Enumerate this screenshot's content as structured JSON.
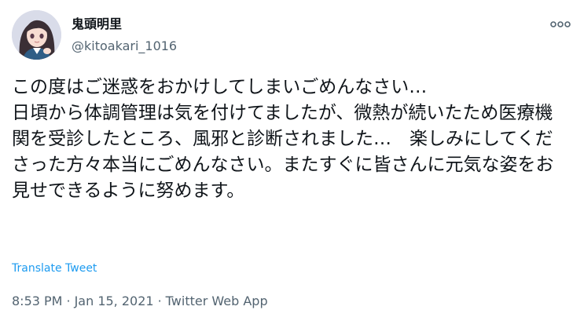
{
  "author": {
    "display_name": "鬼頭明里",
    "handle": "@kitoakari_1016"
  },
  "tweet": {
    "text": "この度はご迷惑をおかけしてしまいごめんなさい…\n日頃から体調管理は気を付けてましたが、微熱が続いたため医療機関を受診したところ、風邪と診断されました…　楽しみにしてくださった方々本当にごめんなさい。またすぐに皆さんに元気な姿をお見せできるように努めます。",
    "translate_label": "Translate Tweet",
    "time": "8:53 PM",
    "date": "Jan 15, 2021",
    "separator": "·",
    "source": "Twitter Web App"
  },
  "icons": {
    "more": "more-dots-icon",
    "avatar": "avatar-image"
  },
  "colors": {
    "text_primary": "#0f1419",
    "text_secondary": "#536471",
    "link": "#1d9bf0"
  }
}
